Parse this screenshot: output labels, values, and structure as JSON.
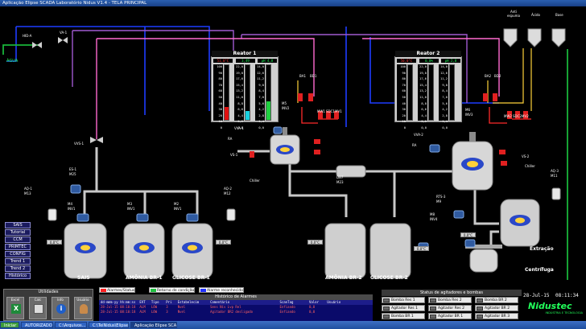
{
  "window": {
    "title": "Aplicação Elipse SCADA Laboratório Nidus V1.4 - TELA PRINCIPAL"
  },
  "colors": {
    "pipe_blue": "#1e3cff",
    "pipe_purple": "#a05ad0",
    "pipe_green": "#18b43a",
    "pipe_grey": "#b0b0b0",
    "pipe_pink": "#ff6ad0",
    "pipe_red": "#ff2a2a",
    "pipe_yellow": "#ffd23a",
    "bg": "#000000"
  },
  "water": {
    "valve_tag": "HID-A",
    "valve2_tag": "VA-1",
    "label": "ÁGUA",
    "vvs_tag": "VVS-1"
  },
  "tanks_top": {
    "labels": [
      "Anti espuma",
      "Ácido",
      "Base"
    ]
  },
  "reactor1": {
    "title": "Reator 1",
    "readouts": [
      "51,0°C",
      "3,49",
      "pH 4,8"
    ],
    "scale": [
      "100",
      "90",
      "80",
      "70",
      "60",
      "50",
      "40",
      "30",
      "20",
      "10",
      "0"
    ],
    "scale2": [
      "22,0",
      "19,8",
      "17,6",
      "15,4",
      "13,2",
      "11,0",
      "8,8",
      "6,6",
      "4,4",
      "2,2",
      "0,0"
    ],
    "scale3": [
      "14,0",
      "12,6",
      "11,2",
      "9,8",
      "8,4",
      "7,0",
      "5,6",
      "4,2",
      "2,8",
      "1,4",
      "0,0"
    ],
    "levels": [
      0.24,
      0.16,
      0.34
    ],
    "tags": {
      "ba": "BA1",
      "bd": "BD1",
      "mv": "MV1",
      "mw": "MW1",
      "sdc": "SDC1",
      "rep": "RE1",
      "m": "M5",
      "inv": "INV2",
      "vv": "VVA-1",
      "ra": "RA",
      "vs": "VS-1",
      "chiller": "Chiller"
    }
  },
  "reactor2": {
    "title": "Reator 2",
    "readouts": [
      "50,0°C",
      "0,0%",
      "pH 2,8"
    ],
    "scale": [
      "100",
      "90",
      "80",
      "70",
      "60",
      "50",
      "40",
      "30",
      "20",
      "10",
      "0"
    ],
    "scale2": [
      "22,0",
      "19,8",
      "17,6",
      "15,4",
      "13,2",
      "11,0",
      "8,8",
      "6,6",
      "4,4",
      "2,2",
      "0,0"
    ],
    "scale3": [
      "14,0",
      "12,6",
      "11,2",
      "9,8",
      "8,4",
      "7,0",
      "5,6",
      "4,2",
      "2,8",
      "1,4",
      "0,0"
    ],
    "levels": [
      0.0,
      0.0,
      0.0
    ],
    "tags": {
      "ba": "BA2",
      "bd": "BD2",
      "mv": "MV2",
      "mw": "MW2",
      "sdc": "SDC2",
      "rep": "RE2",
      "m": "M6",
      "inv": "INV3",
      "vv": "VVA-2",
      "ra": "RA",
      "vs": "VS-2",
      "chiller": "Chiller"
    }
  },
  "mixer": {
    "tag": "DB7",
    "tag2": "M23"
  },
  "tanks_bottom": [
    {
      "name": "SAIS",
      "motor": "M4",
      "inv": "INV1",
      "sensor": "ES-1",
      "m_tag": "M25",
      "aq": "AQ-1",
      "aq2": "M13",
      "temp": "0,0°C"
    },
    {
      "name": "AMÔNIA BR-1",
      "motor": "M3",
      "inv": "INV1"
    },
    {
      "name": "GLICOSE BR-1",
      "motor": "M2",
      "inv": "INV1",
      "aq": "AQ-2",
      "aq2": "M12",
      "temp": "0,0°C"
    },
    {
      "name": "AMÔNIA BR-2"
    },
    {
      "name": "GLICOSE BR-2",
      "temp": "0,0°C",
      "motor": "M8",
      "inv": "INV4"
    }
  ],
  "extraction": {
    "name": "Extração",
    "motor": "M7",
    "inv": "INV",
    "rts": "RTS-3",
    "rts2": "M9",
    "aq": "AQ-3",
    "aq2": "M11"
  },
  "centrifuge": {
    "name": "Centrífuga",
    "temp": "0,0°C"
  },
  "menu": [
    "SAIS",
    "Tutorial",
    "CCM",
    "PRIMTEC",
    "CONFIG",
    "Trend 1",
    "Trend 2",
    "Histórico"
  ],
  "utilities": {
    "title": "Utilidades",
    "buttons": [
      "Excel",
      "Calc",
      "Info",
      "Usuário"
    ]
  },
  "alarms": {
    "legend": [
      "Alarmes/Status",
      "Retorno de condição",
      "Alarme reconhecido"
    ],
    "legend_colors": [
      "#ff2020",
      "#20c040",
      "#2030ff"
    ],
    "title": "Histórico de Alarmes",
    "columns": [
      "dd-mmm-yy hh:mm:ss",
      "EVT",
      "Tipo",
      "Pri",
      "Estabelecim",
      "Comentário",
      "ScanTag",
      "Valor",
      "Usuário"
    ],
    "rows": [
      [
        "28-Jul-15 08:10:18",
        "ALM",
        "LOW",
        "3",
        "Nvel",
        "Sens Nív Lvp Rel",
        "Enfiando",
        "0,0",
        ""
      ],
      [
        "28-Jul-15 08:10:18",
        "ALM",
        "LOW",
        "3",
        "Nvel",
        "Agitador BR2 desligado",
        "Enfiando",
        "0,0",
        ""
      ]
    ]
  },
  "agitators": {
    "title": "Status de agitadores e bombas",
    "items": [
      [
        "Bomba Res 1",
        "Bomba Res 2",
        "Bomba BR 2"
      ],
      [
        "Agitador Res 1",
        "Agitador Res 2",
        "Agitador BR 2"
      ],
      [
        "Bomba BR 1",
        "Agitador BR 1",
        "Agitador BR 3"
      ]
    ]
  },
  "logo": {
    "text": "Nidustec",
    "tagline": "INDÚSTRIA E TECNOLOGIA"
  },
  "status": {
    "date": "28-Jul-15",
    "time": "08:11:34"
  },
  "taskbar": {
    "start": "Iniciar",
    "items": [
      "AUTORIZADO...",
      "C:\\Arquivos...",
      "C:\\TeiNidus\\Elipse Scada",
      "Aplicação Elipse SCADA..."
    ]
  }
}
